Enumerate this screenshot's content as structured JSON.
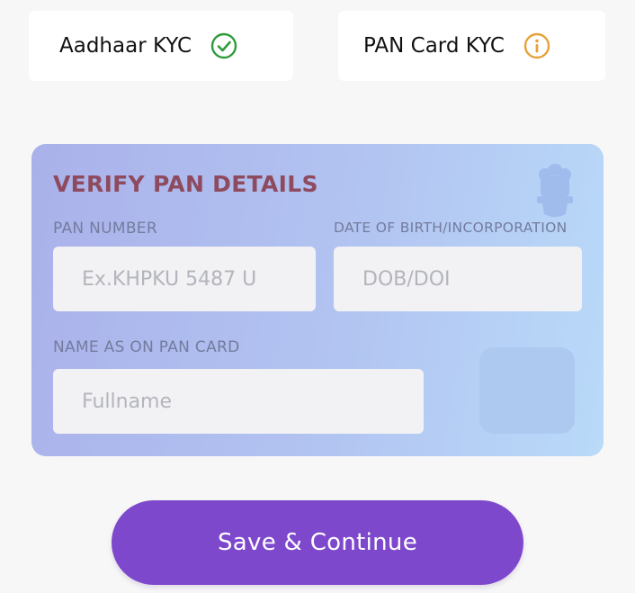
{
  "kyc_tabs": {
    "aadhaar": {
      "label": "Aadhaar KYC",
      "status": "verified",
      "icon": "check-circle-icon",
      "icon_color": "#2e9b3a"
    },
    "pan": {
      "label": "PAN Card KYC",
      "status": "pending",
      "icon": "info-circle-icon",
      "icon_color": "#e8a13a"
    }
  },
  "pan_card": {
    "title": "VERIFY PAN DETAILS",
    "emblem_icon": "ashoka-emblem-icon",
    "pan_number": {
      "label": "PAN NUMBER",
      "placeholder": "Ex.KHPKU 5487 U",
      "value": ""
    },
    "dob": {
      "label": "DATE OF BIRTH/INCORPORATION",
      "placeholder": "DOB/DOI",
      "value": ""
    },
    "name": {
      "label": "NAME AS ON PAN CARD",
      "placeholder": "Fullname",
      "value": ""
    }
  },
  "save_button": {
    "label": "Save & Continue"
  },
  "colors": {
    "accent": "#7e48cc",
    "title": "#8e4a5e",
    "verified": "#2e9b3a",
    "pending": "#e8a13a"
  }
}
